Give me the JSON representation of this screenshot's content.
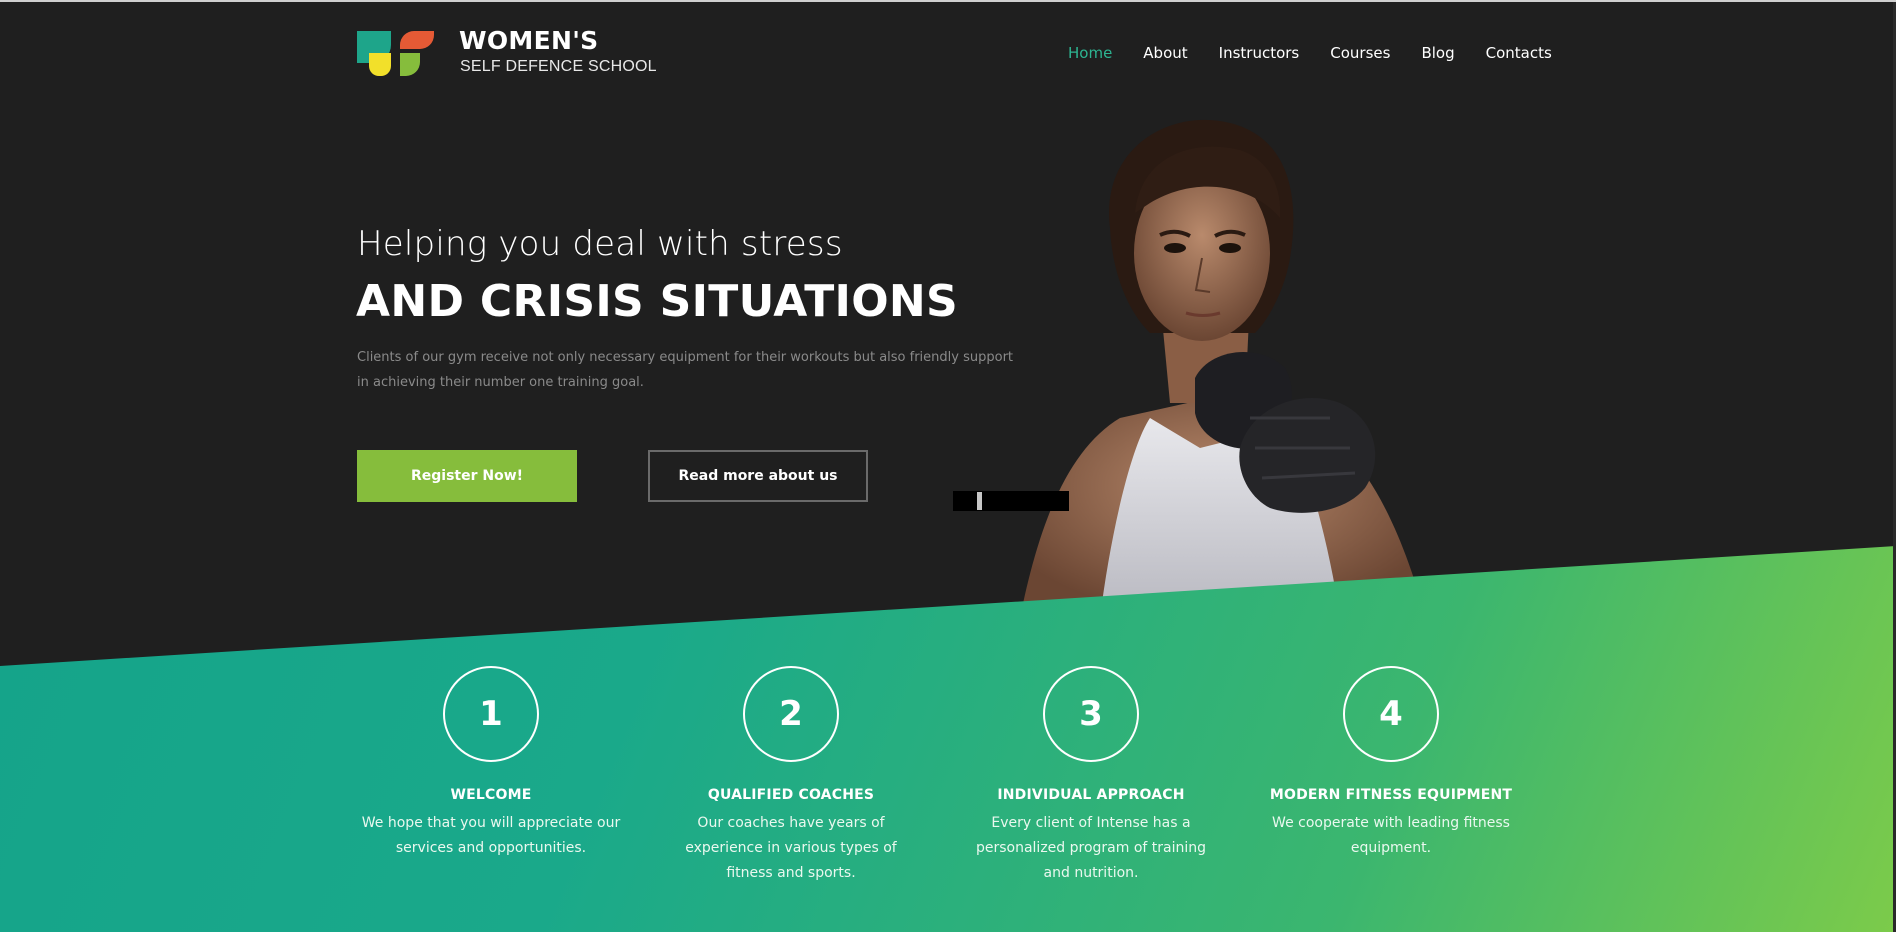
{
  "brand": {
    "title": "WOMEN'S",
    "subtitle": "SELF DEFENCE SCHOOL",
    "colors": {
      "teal": "#1ea58a",
      "orange": "#e55a35",
      "yellow": "#f2e02a",
      "green": "#86bd3c"
    }
  },
  "nav": {
    "items": [
      "Home",
      "About",
      "Instructors",
      "Courses",
      "Blog",
      "Contacts"
    ],
    "active": "Home",
    "active_color": "#2db592"
  },
  "hero": {
    "subline": "Helping you deal with stress",
    "headline": "AND CRISIS SITUATIONS",
    "text": "Clients of our gym receive not only necessary equipment for their workouts but also friendly support in achieving their number one training goal.",
    "primary_button": "Register Now!",
    "secondary_button": "Read more about us",
    "primary_color": "#86bd3c"
  },
  "features": [
    {
      "number": "1",
      "title": "WELCOME",
      "text": "We hope that you will appreciate our services and opportunities."
    },
    {
      "number": "2",
      "title": "QUALIFIED COACHES",
      "text": "Our coaches have years of experience in various types of fitness and sports."
    },
    {
      "number": "3",
      "title": "INDIVIDUAL APPROACH",
      "text": "Every client of Intense has a personalized program of training and nutrition."
    },
    {
      "number": "4",
      "title": "MODERN FITNESS EQUIPMENT",
      "text": "We cooperate with leading fitness equipment."
    }
  ],
  "band_gradient": [
    "#13a28a",
    "#7ccb4a"
  ]
}
